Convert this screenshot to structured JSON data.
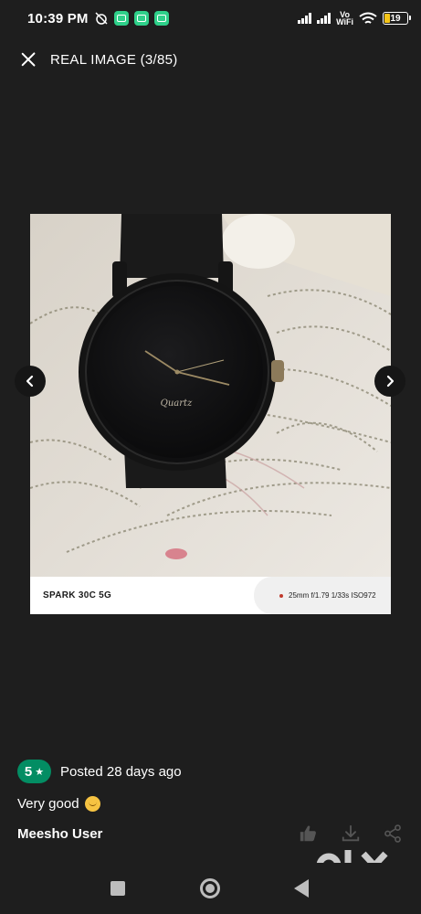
{
  "status_bar": {
    "time": "10:39 PM",
    "network_label_top": "Vo",
    "network_label_bottom": "WiFi",
    "battery_level": "19"
  },
  "header": {
    "title": "REAL IMAGE (3/85)"
  },
  "photo": {
    "device": "SPARK 30C 5G",
    "exif": "25mm f/1.79 1/33s ISO972",
    "watch_brand_text": "Quartz"
  },
  "review": {
    "rating": "5",
    "posted": "Posted 28 days ago",
    "text": "Very good",
    "user": "Meesho User"
  },
  "icons": {
    "close": "close-icon",
    "prev": "chevron-left-icon",
    "next": "chevron-right-icon",
    "like": "thumbs-up-icon",
    "download": "download-icon",
    "share": "share-icon"
  },
  "colors": {
    "background": "#1e1e1e",
    "rating_badge": "#038d63"
  }
}
